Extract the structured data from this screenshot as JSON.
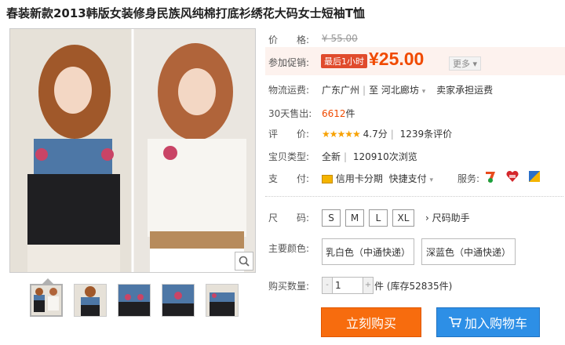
{
  "title": "春装新款2013韩版女装修身民族风纯棉打底衫绣花大码女士短袖T恤",
  "price": {
    "label": "价　　格:",
    "original": "¥ 55.00"
  },
  "promo": {
    "label": "参加促销:",
    "tag": "最后1小时",
    "symbol": "¥",
    "price": "25.00",
    "more": "更多"
  },
  "shipping": {
    "label": "物流运费:",
    "from": "广东广州",
    "sep": "至",
    "to": "河北廊坊",
    "fee": "卖家承担运费"
  },
  "sold": {
    "label": "30天售出:",
    "count": "6612",
    "unit": "件"
  },
  "rating": {
    "label": "评　　价:",
    "stars": "★★★★★",
    "score": "4.7分",
    "reviews": "1239条评价"
  },
  "type": {
    "label": "宝贝类型:",
    "condition": "全新",
    "views": "120910次浏览"
  },
  "payment": {
    "label": "支　　付:",
    "method": "信用卡分期",
    "quick": "快捷支付",
    "service_label": "服务:"
  },
  "size": {
    "label": "尺　　码:",
    "options": [
      "S",
      "M",
      "L",
      "XL"
    ],
    "helper": "尺码助手"
  },
  "color": {
    "label": "主要颜色:",
    "options": [
      "乳白色（中通快递）",
      "深蓝色（中通快递）"
    ]
  },
  "quantity": {
    "label": "购买数量:",
    "value": "1",
    "minus": "-",
    "plus": "+",
    "stock": "件 (库存52835件)"
  },
  "buttons": {
    "buy": "立刻购买",
    "cart": "加入购物车"
  },
  "colors": {
    "accent": "#f04a00",
    "buy": "#f76c0e",
    "cart": "#2d8fe6",
    "promo_tag": "#e04b2c",
    "stars": "#f7a100"
  }
}
